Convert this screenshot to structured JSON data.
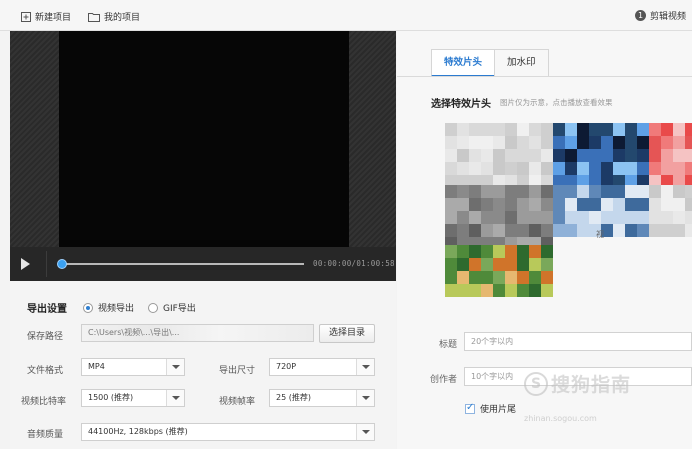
{
  "toolbar": {
    "new_project": "新建项目",
    "my_projects": "我的项目",
    "help_badge": "1",
    "help_label": "剪辑视频"
  },
  "player": {
    "timecode": "00:00:00/01:00:58",
    "progress": 0.0
  },
  "export": {
    "title": "导出设置",
    "option_video": "视频导出",
    "option_gif": "GIF导出",
    "selected": "video",
    "save_path_label": "保存路径",
    "save_path_value": "C:\\Users\\视频\\...\\导出\\...",
    "choose_dir_button": "选择目录",
    "format_label": "文件格式",
    "format_value": "MP4",
    "size_label": "导出尺寸",
    "size_value": "720P",
    "bitrate_label": "视频比特率",
    "bitrate_value": "1500 (推荐)",
    "framerate_label": "视频帧率",
    "framerate_value": "25 (推荐)",
    "audio_label": "音频质量",
    "audio_value": "44100Hz, 128kbps (推荐)"
  },
  "right_panel": {
    "tabs": [
      {
        "label": "特效片头",
        "active": true
      },
      {
        "label": "加水印",
        "active": false
      }
    ],
    "select_title": "选择特效片头",
    "select_hint": "图片仅为示意，点击播放查看效果",
    "thumb_caption": "视",
    "title_label": "标题",
    "title_placeholder": "20个字以内",
    "author_label": "创作者",
    "author_placeholder": "10个字以内",
    "use_intro_label": "使用片尾",
    "use_intro_checked": true
  },
  "watermark": {
    "text": "搜狗指南",
    "url": "zhinan.sogou.com"
  },
  "colors": {
    "accent": "#2b7bd0",
    "player_bg": "#060606",
    "knob": "#3aa0f0"
  }
}
